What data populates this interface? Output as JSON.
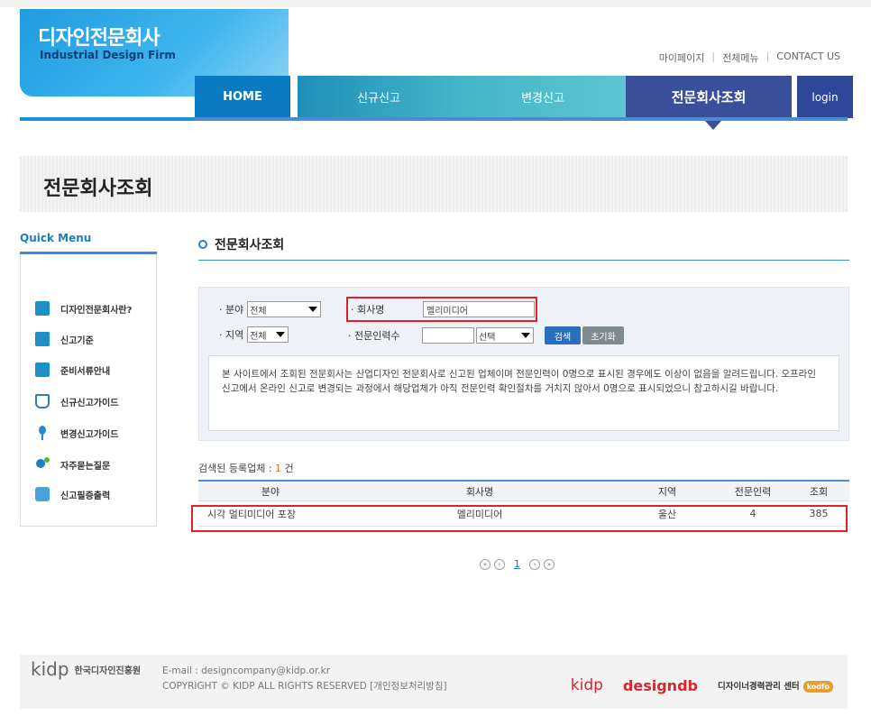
{
  "site": {
    "logo_ko": "디자인전문회사",
    "logo_en": "Industrial Design Firm"
  },
  "util_links": [
    "마이페이지",
    "전체메뉴",
    "CONTACT US"
  ],
  "nav": {
    "home": "HOME",
    "new_report": "신규신고",
    "change_report": "변경신고",
    "company_search": "전문회사조회",
    "login": "login"
  },
  "page_title": "전문회사조회",
  "quick_menu": {
    "title": "Quick Menu",
    "items": [
      {
        "label": "디자인전문회사란?",
        "icon": "building-icon"
      },
      {
        "label": "신고기준",
        "icon": "document-icon"
      },
      {
        "label": "준비서류안내",
        "icon": "paper-icon"
      },
      {
        "label": "신규신고가이드",
        "icon": "book-icon"
      },
      {
        "label": "변경신고가이드",
        "icon": "pin-icon"
      },
      {
        "label": "자주묻는질문",
        "icon": "people-icon"
      },
      {
        "label": "신고필증출력",
        "icon": "stack-icon"
      }
    ]
  },
  "section_title": "전문회사조회",
  "search": {
    "field_label": "· 분야",
    "field_value": "전체",
    "company_label": "· 회사명",
    "company_value": "멜리미디어",
    "region_label": "· 지역",
    "region_value": "전체",
    "staff_label": "· 전문인력수",
    "staff_value": "",
    "staff_select": "선택",
    "search_button": "검색",
    "reset_button": "초기화"
  },
  "notice": "본 사이트에서 조회된 전문회사는 산업디자인 전문회사로 신고된 업체이며 전문인력이 0명으로 표시된 경우에도 이상이 없음을 알려드립니다. 오프라인 신고에서 온라인 신고로 변경되는 과정에서 해당업체가 아직 전문인력 확인절차를 거치지 않아서 0명으로 표시되었으니 참고하시길 바랍니다.",
  "result": {
    "prefix": "검색된 등록업체 : ",
    "count": "1",
    "suffix": " 건"
  },
  "table": {
    "headers": [
      "분야",
      "회사명",
      "지역",
      "전문인력",
      "조회"
    ],
    "rows": [
      [
        "시각 멀티미디어 포장",
        "멜리미디어",
        "울산",
        "4",
        "385"
      ]
    ]
  },
  "pager": {
    "first": "«",
    "prev": "‹",
    "current": "1",
    "next": "›",
    "last": "»"
  },
  "footer": {
    "logo": "kidp",
    "org": "한국디자인진흥원",
    "email": "E-mail : designcompany@kidp.or.kr",
    "copyright": "COPYRIGHT © KIDP ALL RIGHTS RESERVED [개인정보처리방침]",
    "right_logo1": "kidp",
    "right_logo2": "designdb",
    "right_center": "디자이너경력관리 센터",
    "right_badge": "kodfo"
  },
  "colors": {
    "nav_home": "#0a7ac3",
    "nav_active": "#3a4f9a",
    "highlight_red": "#e0202a"
  }
}
